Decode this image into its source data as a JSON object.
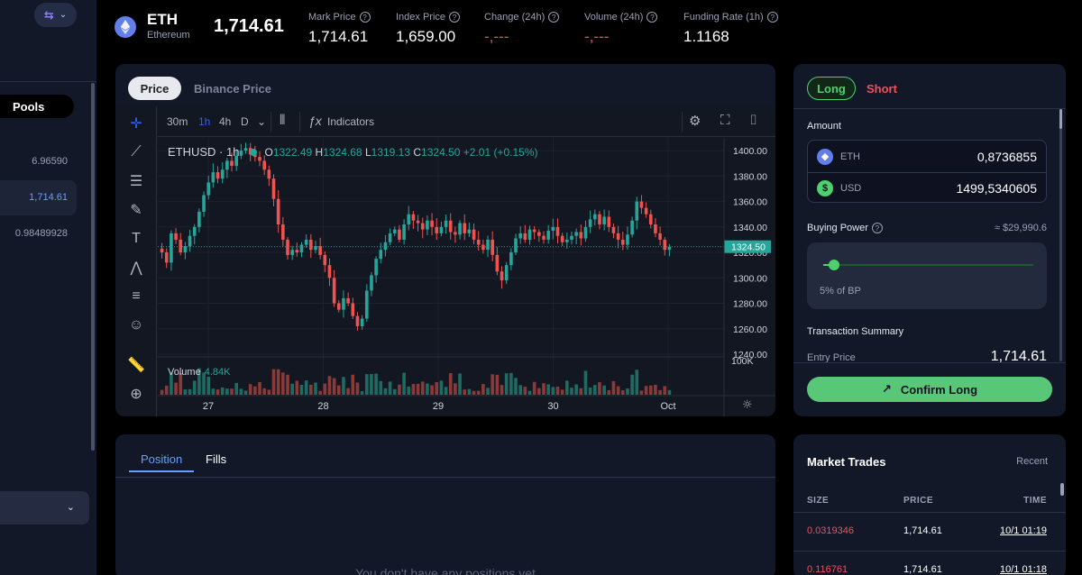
{
  "colors": {
    "bg": "#000000",
    "panel": "#131829",
    "accent_green": "#4cd16e",
    "accent_red": "#f0505a",
    "accent_blue": "#6a9cff",
    "tv_bg": "#131722"
  },
  "sidebar": {
    "logo_icon": "arrows-swap-icon",
    "pools_label": "Pools",
    "values": [
      "6.96590",
      "1,714.61",
      "0.98489928"
    ]
  },
  "header": {
    "symbol": "ETH",
    "name": "Ethereum",
    "price": "1,714.61",
    "stats": [
      {
        "label": "Mark Price",
        "value": "1,714.61"
      },
      {
        "label": "Index Price",
        "value": "1,659.00"
      },
      {
        "label": "Change (24h)",
        "value": "-,---"
      },
      {
        "label": "Volume (24h)",
        "value": "-,---"
      },
      {
        "label": "Funding Rate (1h)",
        "value": "1.1168"
      }
    ]
  },
  "chart_panel": {
    "tabs": [
      "Price",
      "Binance Price"
    ],
    "timeframes": [
      "30m",
      "1h",
      "4h",
      "D"
    ],
    "active_timeframe": "1h",
    "indicators_label": "Indicators",
    "legend": {
      "symbol": "ETHUSD · 1h",
      "o_label": "O",
      "o": "1322.49",
      "h_label": "H",
      "h": "1324.68",
      "l_label": "L",
      "l": "1319.13",
      "c_label": "C",
      "c": "1324.50",
      "change": "+2.01 (+0.15%)"
    },
    "volume_label": "Volume",
    "volume_value": "4.84K",
    "volume_axis_label": "100K"
  },
  "chart_data": {
    "type": "candlestick",
    "title": "ETHUSD",
    "interval": "1h",
    "y_ticks": [
      "1400.00",
      "1380.00",
      "1360.00",
      "1340.00",
      "1320.00",
      "1300.00",
      "1280.00",
      "1260.00",
      "1240.00"
    ],
    "ylim": [
      1240,
      1410
    ],
    "last_price_label": "1324.50",
    "x_ticks": [
      "27",
      "28",
      "29",
      "30",
      "Oct"
    ],
    "close": [
      1320,
      1312,
      1335,
      1330,
      1320,
      1325,
      1333,
      1340,
      1352,
      1365,
      1375,
      1383,
      1378,
      1385,
      1392,
      1388,
      1396,
      1400,
      1402,
      1397,
      1395,
      1392,
      1385,
      1378,
      1362,
      1342,
      1330,
      1318,
      1322,
      1320,
      1326,
      1330,
      1322,
      1325,
      1318,
      1310,
      1300,
      1280,
      1275,
      1284,
      1280,
      1270,
      1262,
      1268,
      1290,
      1302,
      1315,
      1322,
      1328,
      1335,
      1338,
      1330,
      1342,
      1350,
      1345,
      1343,
      1338,
      1345,
      1340,
      1335,
      1340,
      1345,
      1336,
      1334,
      1343,
      1335,
      1338,
      1330,
      1326,
      1322,
      1330,
      1318,
      1305,
      1298,
      1310,
      1320,
      1331,
      1335,
      1330,
      1338,
      1336,
      1333,
      1330,
      1337,
      1340,
      1333,
      1328,
      1330,
      1333,
      1336,
      1331,
      1340,
      1346,
      1350,
      1342,
      1348,
      1340,
      1335,
      1330,
      1326,
      1334,
      1345,
      1360,
      1355,
      1350,
      1342,
      1335,
      1330,
      1322,
      1324.5
    ],
    "volume_note": "relative volume bars, one per candle"
  },
  "order_panel": {
    "side_long": "Long",
    "side_short": "Short",
    "amount_label": "Amount",
    "eth_currency": "ETH",
    "eth_amount": "0,8736855",
    "usd_currency": "USD",
    "usd_amount": "1499,5340605",
    "buying_power_label": "Buying Power",
    "buying_power_value": "≈ $29,990.6",
    "slider_percent": 0.05,
    "slider_text": "5% of BP",
    "summary_label": "Transaction Summary",
    "entry_label": "Entry Price",
    "entry_value": "1,714.61",
    "confirm_label": "Confirm Long"
  },
  "positions": {
    "tabs": [
      "Position",
      "Fills"
    ],
    "empty_text": "You don't have any positions yet"
  },
  "market_trades": {
    "title": "Market Trades",
    "recent_label": "Recent",
    "columns": [
      "SIZE",
      "PRICE",
      "TIME"
    ],
    "rows": [
      {
        "size": "0.0319346",
        "price": "1,714.61",
        "time": "10/1 01:19"
      },
      {
        "size": "0.116761",
        "price": "1,714.61",
        "time": "10/1 01:18"
      }
    ]
  }
}
